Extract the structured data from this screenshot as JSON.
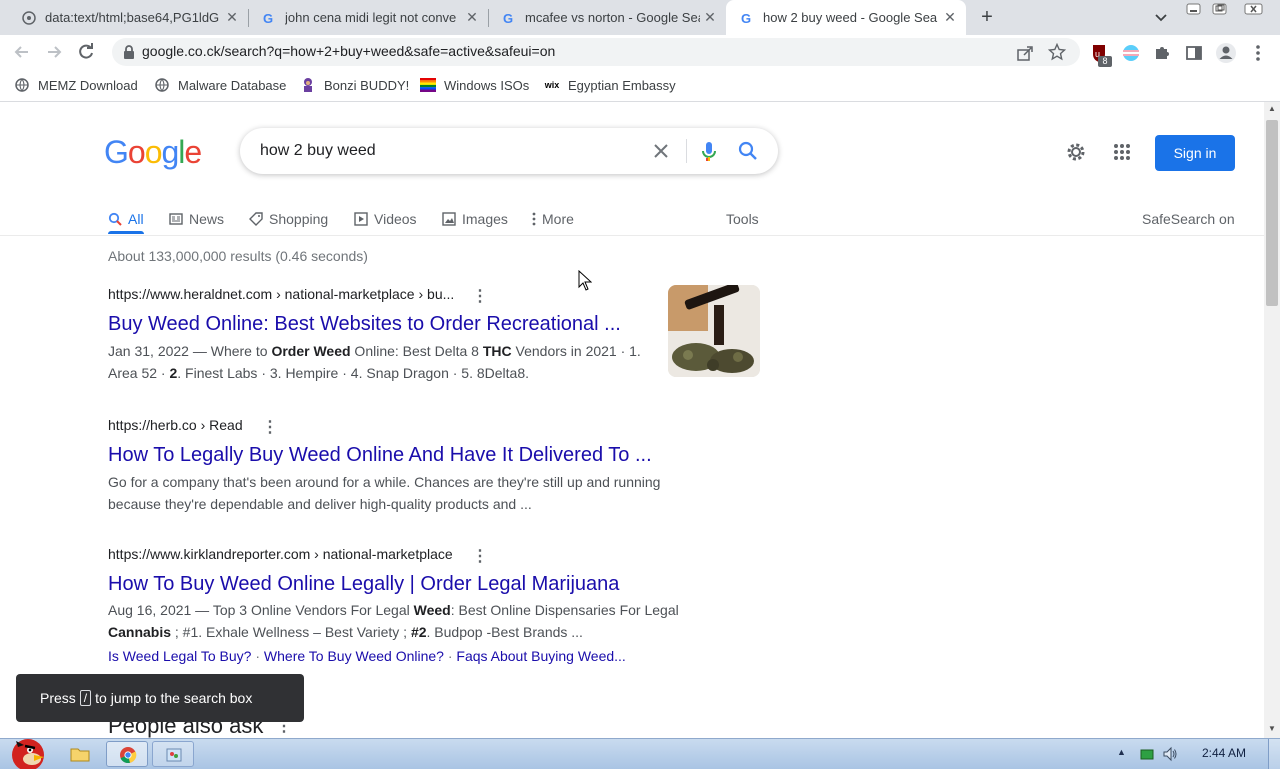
{
  "tabs": [
    {
      "title": "data:text/html;base64,PG1ldG"
    },
    {
      "title": "john cena midi legit not conve"
    },
    {
      "title": "mcafee vs norton - Google Sea"
    },
    {
      "title": "how 2 buy weed - Google Sea"
    }
  ],
  "address_bar": {
    "url": "google.co.ck/search?q=how+2+buy+weed&safe=active&safeui=on"
  },
  "extension_badge": "8",
  "bookmarks": [
    {
      "label": "MEMZ Download"
    },
    {
      "label": "Malware Database"
    },
    {
      "label": "Bonzi BUDDY!"
    },
    {
      "label": "Windows ISOs"
    },
    {
      "label": "Egyptian Embassy"
    }
  ],
  "google": {
    "logo_letters": [
      "G",
      "o",
      "o",
      "g",
      "l",
      "e"
    ],
    "query": "how 2 buy weed",
    "sign_in": "Sign in",
    "nav_tabs": [
      "All",
      "News",
      "Shopping",
      "Videos",
      "Images",
      "More"
    ],
    "tools": "Tools",
    "safesearch": "SafeSearch on",
    "result_stats": "About 133,000,000 results (0.46 seconds)",
    "results": [
      {
        "url": "https://www.heraldnet.com",
        "crumb": " › national-marketplace › bu...",
        "title": "Buy Weed Online: Best Websites to Order Recreational ...",
        "snippet_line1_a": "Jan 31, 2022 — Where to ",
        "snippet_line1_b": "Order Weed",
        "snippet_line1_c": " Online: Best Delta 8 ",
        "snippet_line1_d": "THC",
        "snippet_line1_e": " Vendors in 2021 · 1.",
        "snippet_line2_a": "Area 52 · ",
        "snippet_line2_b": "2",
        "snippet_line2_c": ". Finest Labs · 3. Hempire · 4. Snap Dragon · 5. 8Delta8."
      },
      {
        "url": "https://herb.co",
        "crumb": " › Read",
        "title": "How To Legally Buy Weed Online And Have It Delivered To ...",
        "snippet_line1": "Go for a company that's been around for a while. Chances are they're still up and running",
        "snippet_line2": "because they're dependable and deliver high-quality products and ..."
      },
      {
        "url": "https://www.kirklandreporter.com",
        "crumb": " › national-marketplace",
        "title": "How To Buy Weed Online Legally | Order Legal Marijuana",
        "snippet_line1_a": "Aug 16, 2021 — Top 3 Online Vendors For Legal ",
        "snippet_line1_b": "Weed",
        "snippet_line1_c": ": Best Online Dispensaries For Legal",
        "snippet_line2_a": "Cannabis",
        "snippet_line2_b": " ; #1. Exhale Wellness – Best Variety ; ",
        "snippet_line2_c": "#2",
        "snippet_line2_d": ". Budpop -Best Brands ...",
        "sitelinks": [
          "Is Weed Legal To Buy?",
          "Where To Buy Weed Online?",
          "Faqs About Buying Weed..."
        ]
      }
    ],
    "people_also_ask": "People also ask",
    "toast_a": "Press",
    "toast_key": "/",
    "toast_b": "to jump to the search box"
  },
  "taskbar": {
    "clock": "2:44 AM"
  },
  "colors": {
    "google_blue": "#4285f4",
    "google_red": "#ea4335",
    "google_yellow": "#fbbc05",
    "google_green": "#34a853",
    "link": "#1a0dab",
    "signin": "#1a73e8"
  }
}
